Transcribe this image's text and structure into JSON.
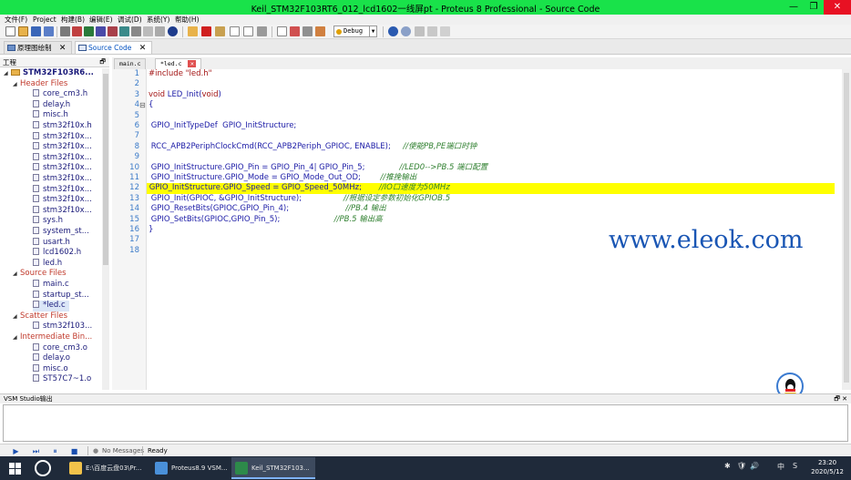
{
  "window": {
    "title": "Keil_STM32F103RT6_012_lcd1602一线屏pt - Proteus 8 Professional - Source Code",
    "minimize_glyph": "—",
    "maximize_glyph": "❐",
    "close_glyph": "✕"
  },
  "menu": [
    "文件(F)",
    "Project",
    "构建(B)",
    "编辑(E)",
    "调试(D)",
    "系统(Y)",
    "帮助(H)"
  ],
  "toolbar": {
    "debug_combo": "Debug",
    "icons": [
      "new-file-icon",
      "open-icon",
      "save-icon",
      "save-all-icon",
      "import-icon",
      "close-project-icon",
      "component-icon",
      "schematic-icon",
      "pcb-icon",
      "3d-icon",
      "gerber-icon",
      "bom-icon",
      "help-icon",
      "build-icon",
      "stop-icon",
      "clean-icon",
      "library-icon",
      "open-file-icon",
      "new-document-icon",
      "print-icon",
      "undo-icon",
      "redo-icon",
      "cut-icon",
      "copy-icon",
      "paste-icon"
    ]
  },
  "doc_tabs": [
    {
      "label": "原理图绘制",
      "active": false
    },
    {
      "label": "Source Code",
      "active": true
    }
  ],
  "project_panel": {
    "title": "工程",
    "pin_glyph": "🗗",
    "tree": [
      {
        "label": "STM32F103R6...",
        "type": "root",
        "level": 0,
        "expander": "◢"
      },
      {
        "label": "Header Files",
        "type": "group",
        "level": 1,
        "expander": "◢"
      },
      {
        "label": "core_cm3.h",
        "type": "file",
        "level": 2
      },
      {
        "label": "delay.h",
        "type": "file",
        "level": 2
      },
      {
        "label": "misc.h",
        "type": "file",
        "level": 2
      },
      {
        "label": "stm32f10x.h",
        "type": "file",
        "level": 2
      },
      {
        "label": "stm32f10x...",
        "type": "file",
        "level": 2
      },
      {
        "label": "stm32f10x...",
        "type": "file",
        "level": 2
      },
      {
        "label": "stm32f10x...",
        "type": "file",
        "level": 2
      },
      {
        "label": "stm32f10x...",
        "type": "file",
        "level": 2
      },
      {
        "label": "stm32f10x...",
        "type": "file",
        "level": 2
      },
      {
        "label": "stm32f10x...",
        "type": "file",
        "level": 2
      },
      {
        "label": "stm32f10x...",
        "type": "file",
        "level": 2
      },
      {
        "label": "stm32f10x...",
        "type": "file",
        "level": 2
      },
      {
        "label": "sys.h",
        "type": "file",
        "level": 2
      },
      {
        "label": "system_st...",
        "type": "file",
        "level": 2
      },
      {
        "label": "usart.h",
        "type": "file",
        "level": 2
      },
      {
        "label": "lcd1602.h",
        "type": "file",
        "level": 2
      },
      {
        "label": "led.h",
        "type": "file",
        "level": 2
      },
      {
        "label": "Source Files",
        "type": "group",
        "level": 1,
        "expander": "◢"
      },
      {
        "label": "main.c",
        "type": "file",
        "level": 2
      },
      {
        "label": "startup_st...",
        "type": "file",
        "level": 2
      },
      {
        "label": "*led.c",
        "type": "file",
        "level": 2,
        "selected": true
      },
      {
        "label": "Scatter Files",
        "type": "group",
        "level": 1,
        "expander": "◢"
      },
      {
        "label": "stm32f103...",
        "type": "file",
        "level": 2
      },
      {
        "label": "Intermediate Bin...",
        "type": "group",
        "level": 1,
        "expander": "◢"
      },
      {
        "label": "core_cm3.o",
        "type": "file",
        "level": 2
      },
      {
        "label": "delay.o",
        "type": "file",
        "level": 2
      },
      {
        "label": "misc.o",
        "type": "file",
        "level": 2
      },
      {
        "label": "ST57C7~1.o",
        "type": "file",
        "level": 2
      }
    ]
  },
  "editor": {
    "tabs": [
      {
        "label": "main.c",
        "active": false,
        "close_glyph": ""
      },
      {
        "label": "*led.c",
        "active": true,
        "close_glyph": "✕"
      }
    ],
    "fold_glyph": "⊟",
    "lines": [
      {
        "n": "1",
        "segs": [
          [
            "pp",
            "#include \"led.h\""
          ]
        ]
      },
      {
        "n": "2",
        "segs": []
      },
      {
        "n": "3",
        "segs": [
          [
            "kw",
            "void"
          ],
          [
            "fn",
            " LED_Init("
          ],
          [
            "kw",
            "void"
          ],
          [
            "fn",
            ")"
          ]
        ]
      },
      {
        "n": "4",
        "segs": [
          [
            "fn",
            "{"
          ]
        ],
        "fold": true
      },
      {
        "n": "5",
        "segs": []
      },
      {
        "n": "6",
        "segs": [
          [
            "fn",
            " GPIO_InitTypeDef  GPIO_InitStructure;"
          ]
        ]
      },
      {
        "n": "7",
        "segs": []
      },
      {
        "n": "8",
        "segs": [
          [
            "fn",
            " RCC_APB2PeriphClockCmd(RCC_APB2Periph_GPIOC, ENABLE);     "
          ],
          [
            "cm",
            "//使能PB,PE端口时钟"
          ]
        ]
      },
      {
        "n": "9",
        "segs": []
      },
      {
        "n": "10",
        "segs": [
          [
            "fn",
            " GPIO_InitStructure.GPIO_Pin = GPIO_Pin_4| GPIO_Pin_5;              "
          ],
          [
            "cm",
            "//LED0-->PB.5 端口配置"
          ]
        ]
      },
      {
        "n": "11",
        "segs": [
          [
            "fn",
            " GPIO_InitStructure.GPIO_Mode = GPIO_Mode_Out_OD;        "
          ],
          [
            "cm",
            "//推挽输出"
          ]
        ]
      },
      {
        "n": "12",
        "segs": [
          [
            "fn",
            " GPIO_InitStructure.GPIO_Speed = GPIO_Speed_50MHz;       "
          ],
          [
            "cm",
            "//IO口速度为50MHz"
          ]
        ],
        "highlight": true
      },
      {
        "n": "13",
        "segs": [
          [
            "fn",
            " GPIO_Init(GPIOC, &GPIO_InitStructure);                 "
          ],
          [
            "cm",
            "//根据设定参数初始化GPIOB.5"
          ]
        ]
      },
      {
        "n": "14",
        "segs": [
          [
            "fn",
            " GPIO_ResetBits(GPIOC,GPIO_Pin_4);                       "
          ],
          [
            "cm",
            "//PB.4 输出"
          ]
        ]
      },
      {
        "n": "15",
        "segs": [
          [
            "fn",
            " GPIO_SetBits(GPIOC,GPIO_Pin_5);                      "
          ],
          [
            "cm",
            "//PB.5 输出高"
          ]
        ]
      },
      {
        "n": "16",
        "segs": [
          [
            "fn",
            "}"
          ]
        ]
      },
      {
        "n": "17",
        "segs": []
      },
      {
        "n": "18",
        "segs": []
      }
    ],
    "watermark": "www.eleok.com"
  },
  "vsm": {
    "title": "VSM Studio输出",
    "controls": "🗗 ✕"
  },
  "status": {
    "play_glyph": "▶",
    "step_glyph": "⏭",
    "pause_glyph": "⏸",
    "stop_glyph": "■",
    "messages": "No Messages",
    "state": "Ready"
  },
  "taskbar": {
    "tasks": [
      {
        "label": "E:\\百度云盘03\\Pr...",
        "color": "#f2c24a",
        "active": false
      },
      {
        "label": "Proteus8.9 VSM...",
        "color": "#4a90d9",
        "active": false
      },
      {
        "label": "Keil_STM32F103...",
        "color": "#2d8a4a",
        "active": true
      }
    ],
    "tray_glyphs": [
      "✱",
      "🛡",
      "🔊",
      "中",
      "S"
    ],
    "time": "23:20",
    "date": "2020/5/12"
  },
  "colors": {
    "title_bar": "#19e24a",
    "highlight_line": "#ffff00",
    "watermark": "#1a56b4"
  }
}
